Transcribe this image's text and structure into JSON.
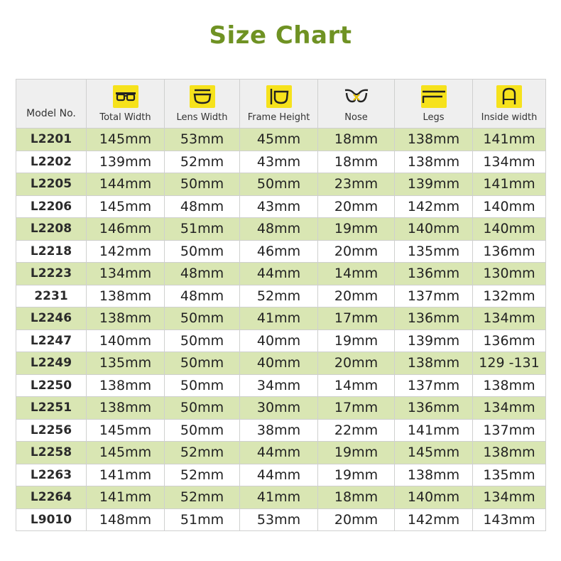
{
  "title": "Size Chart",
  "colors": {
    "title": "#6f9223",
    "row_highlight": "#d9e6b3",
    "header_bg": "#efefef",
    "icon_bg": "#f6e21c"
  },
  "columns": [
    {
      "label": "Model No.",
      "icon": null
    },
    {
      "label": "Total Width",
      "icon": "total-width-glasses-icon"
    },
    {
      "label": "Lens Width",
      "icon": "lens-width-icon"
    },
    {
      "label": "Frame Height",
      "icon": "frame-height-icon"
    },
    {
      "label": "Nose",
      "icon": "nose-bridge-icon"
    },
    {
      "label": "Legs",
      "icon": "temple-legs-icon"
    },
    {
      "label": "Inside width",
      "icon": "inside-width-icon"
    }
  ],
  "rows": [
    [
      "L2201",
      "145mm",
      "53mm",
      "45mm",
      "18mm",
      "138mm",
      "141mm"
    ],
    [
      "L2202",
      "139mm",
      "52mm",
      "43mm",
      "18mm",
      "138mm",
      "134mm"
    ],
    [
      "L2205",
      "144mm",
      "50mm",
      "50mm",
      "23mm",
      "139mm",
      "141mm"
    ],
    [
      "L2206",
      "145mm",
      "48mm",
      "43mm",
      "20mm",
      "142mm",
      "140mm"
    ],
    [
      "L2208",
      "146mm",
      "51mm",
      "48mm",
      "19mm",
      "140mm",
      "140mm"
    ],
    [
      "L2218",
      "142mm",
      "50mm",
      "46mm",
      "20mm",
      "135mm",
      "136mm"
    ],
    [
      "L2223",
      "134mm",
      "48mm",
      "44mm",
      "14mm",
      "136mm",
      "130mm"
    ],
    [
      "2231",
      "138mm",
      "48mm",
      "52mm",
      "20mm",
      "137mm",
      "132mm"
    ],
    [
      "L2246",
      "138mm",
      "50mm",
      "41mm",
      "17mm",
      "136mm",
      "134mm"
    ],
    [
      "L2247",
      "140mm",
      "50mm",
      "40mm",
      "19mm",
      "139mm",
      "136mm"
    ],
    [
      "L2249",
      "135mm",
      "50mm",
      "40mm",
      "20mm",
      "138mm",
      "129 -131"
    ],
    [
      "L2250",
      "138mm",
      "50mm",
      "34mm",
      "14mm",
      "137mm",
      "138mm"
    ],
    [
      "L2251",
      "138mm",
      "50mm",
      "30mm",
      "17mm",
      "136mm",
      "134mm"
    ],
    [
      "L2256",
      "145mm",
      "50mm",
      "38mm",
      "22mm",
      "141mm",
      "137mm"
    ],
    [
      "L2258",
      "145mm",
      "52mm",
      "44mm",
      "19mm",
      "145mm",
      "138mm"
    ],
    [
      "L2263",
      "141mm",
      "52mm",
      "44mm",
      "19mm",
      "138mm",
      "135mm"
    ],
    [
      "L2264",
      "141mm",
      "52mm",
      "41mm",
      "18mm",
      "140mm",
      "134mm"
    ],
    [
      "L9010",
      "148mm",
      "51mm",
      "53mm",
      "20mm",
      "142mm",
      "143mm"
    ]
  ]
}
